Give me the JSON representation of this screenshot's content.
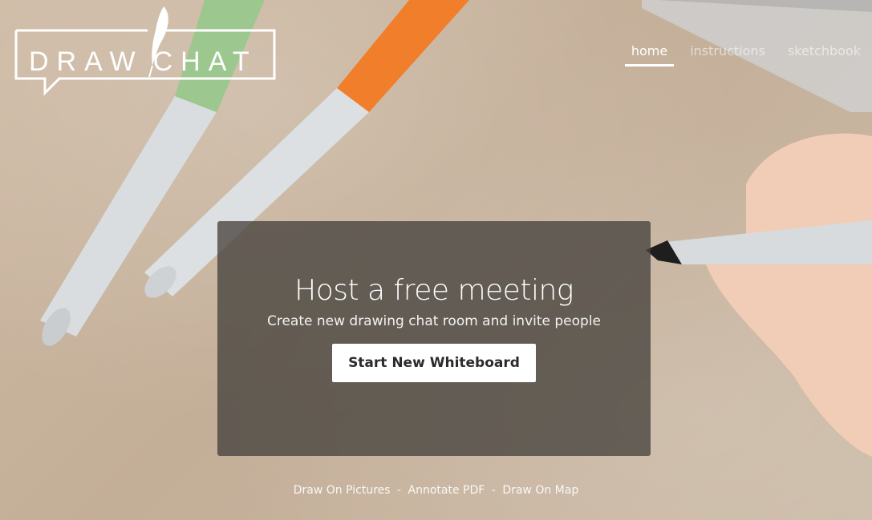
{
  "logo": {
    "part1": "DRAW",
    "part2": "CHAT",
    "icon": "feather-quill-icon"
  },
  "nav": {
    "items": [
      {
        "label": "home",
        "active": true
      },
      {
        "label": "instructions",
        "active": false
      },
      {
        "label": "sketchbook",
        "active": false
      }
    ]
  },
  "hero": {
    "title": "Host a free meeting",
    "subtitle": "Create new drawing chat room and invite people",
    "button_label": "Start New Whiteboard"
  },
  "footer": {
    "links": [
      {
        "label": "Draw On Pictures"
      },
      {
        "label": "Annotate PDF"
      },
      {
        "label": "Draw On Map"
      }
    ],
    "separator": "-"
  },
  "colors": {
    "background": "#c9b7a2",
    "hero_overlay": "#46423e",
    "button_bg": "#ffffff",
    "text": "#ffffff"
  }
}
